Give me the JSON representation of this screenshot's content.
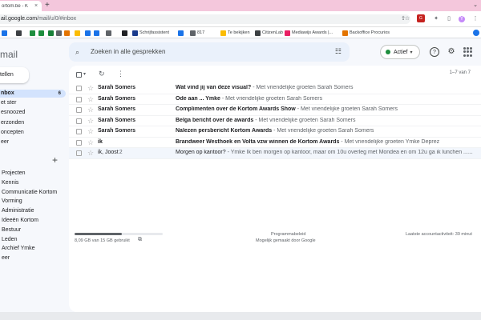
{
  "browser": {
    "tab_title": "ortom.be - K",
    "tab_close": "×",
    "new_tab": "+",
    "url_host": "ail.google.com",
    "url_path": "/mail/u/0/#inbox",
    "tab_search": "⌄",
    "addr_icons": [
      "share-icon",
      "star-icon",
      "puzzle-icon",
      "profile-icon",
      "menu-icon"
    ],
    "ext_label": "G"
  },
  "bookmarks": [
    {
      "label": "",
      "color": "#1a73e8"
    },
    {
      "label": "",
      "color": "#3c4043"
    },
    {
      "label": "",
      "color": "#1e8e3e"
    },
    {
      "label": "",
      "color": "#1e8e3e"
    },
    {
      "label": "",
      "color": "#188038"
    },
    {
      "label": "",
      "color": "#5f6368"
    },
    {
      "label": "",
      "color": "#e37400"
    },
    {
      "label": "",
      "color": "#fbbc04"
    },
    {
      "label": "",
      "color": "#1a73e8"
    },
    {
      "label": "",
      "color": "#1a73e8"
    },
    {
      "label": "",
      "color": "#5f6368"
    },
    {
      "label": "",
      "color": "#202124"
    },
    {
      "label": "Schrijfassistent",
      "color": "#1a3a8c"
    },
    {
      "label": "",
      "color": "#1a73e8"
    },
    {
      "label": "817",
      "color": "#5f6368"
    },
    {
      "label": "Te bekijken",
      "color": "#fbbc04"
    },
    {
      "label": "CitizenLab",
      "color": "#3c4043"
    },
    {
      "label": "Mediawijs Awards |...",
      "color": "#e91e63"
    },
    {
      "label": "Backoffice Procurios",
      "color": "#e37400"
    }
  ],
  "nav": {
    "logo": "mail",
    "compose": "tellen",
    "items": [
      {
        "label": "nbox",
        "count": "6",
        "active": true
      },
      {
        "label": "et ster",
        "count": "",
        "active": false
      },
      {
        "label": "esnoozed",
        "count": "",
        "active": false
      },
      {
        "label": "erzonden",
        "count": "",
        "active": false
      },
      {
        "label": "oncepten",
        "count": "",
        "active": false
      },
      {
        "label": "eer",
        "count": "",
        "active": false
      }
    ],
    "labels_add": "+",
    "labels": [
      "Projecten",
      "Kennis",
      "Communicatie Kortom",
      "Vorming",
      "Administratie",
      "Ideeën Kortom",
      "Bestuur",
      "Leden",
      "Archief Ymke",
      "eer"
    ]
  },
  "search": {
    "icon": "⌕",
    "placeholder": "Zoeken in alle gesprekken",
    "filter_icon": "☷"
  },
  "status": {
    "label": "Actief",
    "caret": "▾",
    "color": "#1e8e3e"
  },
  "header_icons": {
    "help": "?",
    "settings": "⚙"
  },
  "toolbar": {
    "caret": "▾",
    "refresh": "↻",
    "more": "⋮",
    "pagination": "1–7 van 7"
  },
  "emails": [
    {
      "sender": "Sarah Somers",
      "count": "",
      "subject": "Wat vind jij van deze visual?",
      "snippet": " - Met vriendelijke groeten Sarah Somers",
      "read": false
    },
    {
      "sender": "Sarah Somers",
      "count": "",
      "subject": "Ode aan ... Ymke",
      "snippet": " - Met vriendelijke groeten Sarah Somers",
      "read": false
    },
    {
      "sender": "Sarah Somers",
      "count": "",
      "subject": "Complimenten over de Kortom Awards Show",
      "snippet": " - Met vriendelijke groeten Sarah Somers",
      "read": false
    },
    {
      "sender": "Sarah Somers",
      "count": "",
      "subject": "Belga bericht over de awards",
      "snippet": " - Met vriendelijke groeten Sarah Somers",
      "read": false
    },
    {
      "sender": "Sarah Somers",
      "count": "",
      "subject": "Nalezen persbericht Kortom Awards",
      "snippet": " - Met vriendelijke groeten Sarah Somers",
      "read": false
    },
    {
      "sender": "ik",
      "count": "",
      "subject": "Brandweer Westhoek en Volta vzw winnen de Kortom Awards",
      "snippet": " - Met vriendelijke groeten Ymke Deprez",
      "read": false
    },
    {
      "sender": "ik, Joost",
      "count": "2",
      "subject": "Morgen op kantoor?",
      "snippet": " - Ymke Ik ben morgen op kantoor, maar om 10u overleg met Mondea en om 12u ga ik lunchen ......",
      "read": true
    }
  ],
  "footer": {
    "storage_used_fraction": 0.54,
    "storage_text": "8,09 GB van 15 GB gebruikt",
    "storage_link_icon": "⧉",
    "policy": "Programmabeleid",
    "powered_by": "Mogelijk gemaakt door Google",
    "activity": "Laatste accountactiviteit: 39 minut"
  }
}
